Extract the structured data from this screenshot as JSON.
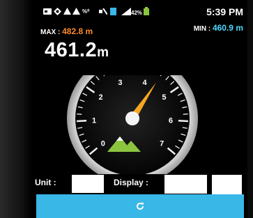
{
  "status": {
    "battery_percent": "42%",
    "time": "5:39 PM",
    "icons": [
      "card-icon",
      "gps-icon",
      "warning-icon",
      "warning-icon",
      "wifi-icon",
      "mute-icon",
      "sim-icon",
      "signal-icon",
      "battery-icon"
    ]
  },
  "stats": {
    "max_label": "MAX :",
    "max_value": "482.8 m",
    "min_label": "MIN :",
    "min_value": "460.9 m"
  },
  "altitude": {
    "value": "461.2",
    "unit": "m"
  },
  "gauge": {
    "dial_labels": [
      "0",
      "1",
      "2",
      "3",
      "4",
      "5",
      "6",
      "7"
    ],
    "needle_value": 4.4,
    "accent_color": "#f5a623",
    "logo_color": "#8bc53f"
  },
  "controls": {
    "unit_label": "Unit :",
    "display_label": "Display :"
  },
  "colors": {
    "max": "#ff8a2a",
    "min": "#4fd8ff",
    "button": "#39b7e6"
  }
}
